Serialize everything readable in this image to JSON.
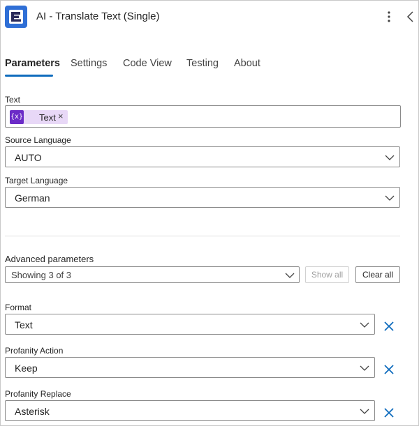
{
  "header": {
    "title": "AI - Translate Text (Single)",
    "logo_icon": "encodian-logo-icon",
    "more_icon": "more-vertical-icon",
    "collapse_icon": "chevron-left-icon",
    "brand_color": "#2f6fd6"
  },
  "tabs": [
    {
      "label": "Parameters",
      "active": true
    },
    {
      "label": "Settings",
      "active": false
    },
    {
      "label": "Code View",
      "active": false
    },
    {
      "label": "Testing",
      "active": false
    },
    {
      "label": "About",
      "active": false
    }
  ],
  "accent_color": "#0f6cbd",
  "fields": {
    "text": {
      "label": "Text",
      "token": {
        "icon_text": "{x}",
        "label": "Text",
        "remove": "×"
      }
    },
    "source_language": {
      "label": "Source Language",
      "value": "AUTO"
    },
    "target_language": {
      "label": "Target Language",
      "value": "German"
    }
  },
  "advanced": {
    "label": "Advanced parameters",
    "dropdown_value": "Showing 3 of 3",
    "show_all": "Show all",
    "clear_all": "Clear all"
  },
  "advanced_fields": {
    "format": {
      "label": "Format",
      "value": "Text"
    },
    "profanity_action": {
      "label": "Profanity Action",
      "value": "Keep"
    },
    "profanity_replace": {
      "label": "Profanity Replace",
      "value": "Asterisk"
    }
  },
  "remove_icon_color": "#0f6cbd"
}
